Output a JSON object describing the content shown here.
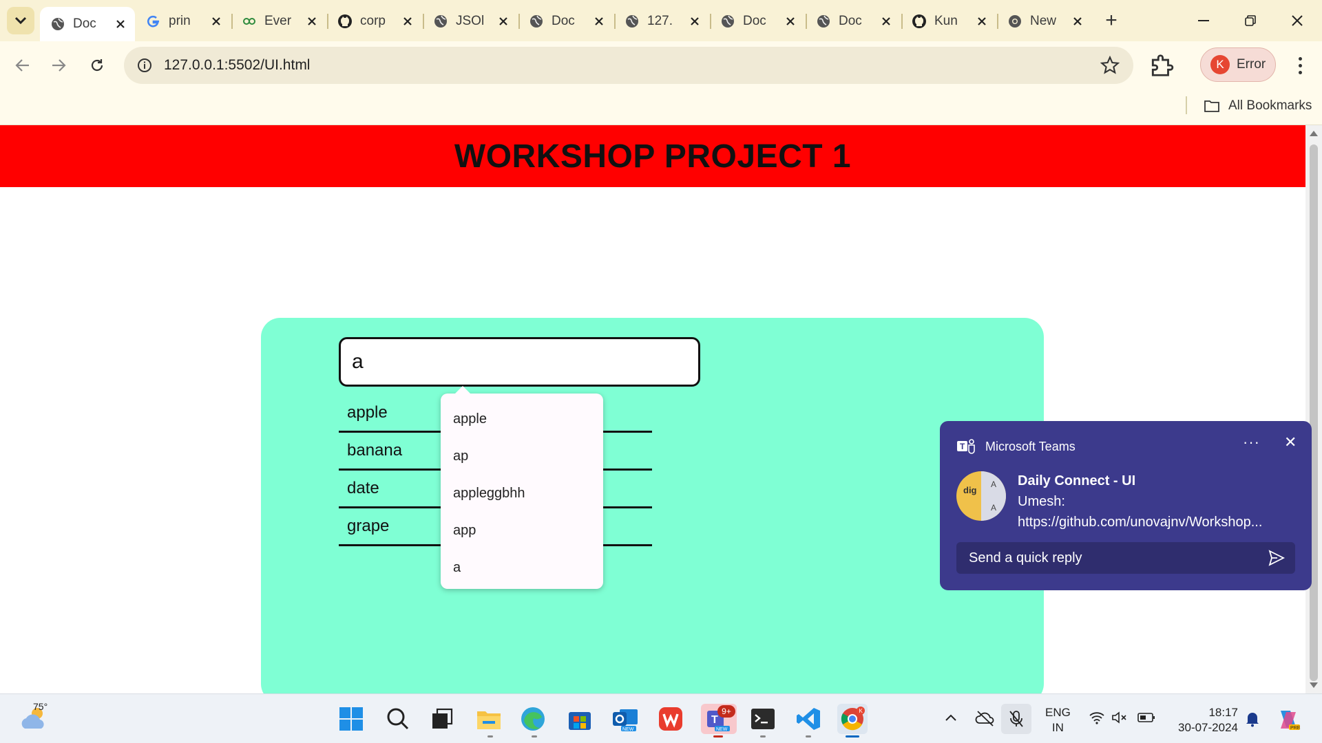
{
  "browser": {
    "tabs": [
      {
        "title": "Doc",
        "icon": "globe-icon",
        "active": true
      },
      {
        "title": "prin",
        "icon": "google-icon"
      },
      {
        "title": "Ever",
        "icon": "evernote-icon"
      },
      {
        "title": "corp",
        "icon": "github-icon"
      },
      {
        "title": "JSOl",
        "icon": "globe-icon"
      },
      {
        "title": "Doc",
        "icon": "globe-icon"
      },
      {
        "title": "127.",
        "icon": "globe-icon"
      },
      {
        "title": "Doc",
        "icon": "globe-icon"
      },
      {
        "title": "Doc",
        "icon": "globe-icon"
      },
      {
        "title": "Kun",
        "icon": "github-icon"
      },
      {
        "title": "New",
        "icon": "chrome-icon"
      }
    ],
    "url": "127.0.0.1:5502/UI.html",
    "profile": {
      "initial": "K",
      "label": "Error"
    },
    "bookmarks_label": "All Bookmarks",
    "theme_color": "#f9f2d6"
  },
  "page": {
    "title": "WORKSHOP PROJECT 1",
    "header_color": "#ff0000",
    "card_color": "#7fffd4",
    "search_value": "a",
    "list_items": [
      "apple",
      "banana",
      "date",
      "grape"
    ],
    "autocomplete": [
      "apple",
      "ap",
      "appleggbhh",
      "app",
      "a"
    ]
  },
  "toast": {
    "app_name": "Microsoft Teams",
    "more": "···",
    "close": "✕",
    "title": "Daily Connect - UI",
    "sender": "Umesh:",
    "message": "https://github.com/unovajnv/Workshop...",
    "reply_placeholder": "Send a quick reply",
    "avatar_text": "dig",
    "avatar_initials": [
      "A",
      "A"
    ],
    "color": "#3c3a8c"
  },
  "taskbar": {
    "weather_temp": "75°",
    "teams_badge": "9+",
    "lang_line1": "ENG",
    "lang_line2": "IN",
    "time": "18:17",
    "date": "30-07-2024"
  }
}
